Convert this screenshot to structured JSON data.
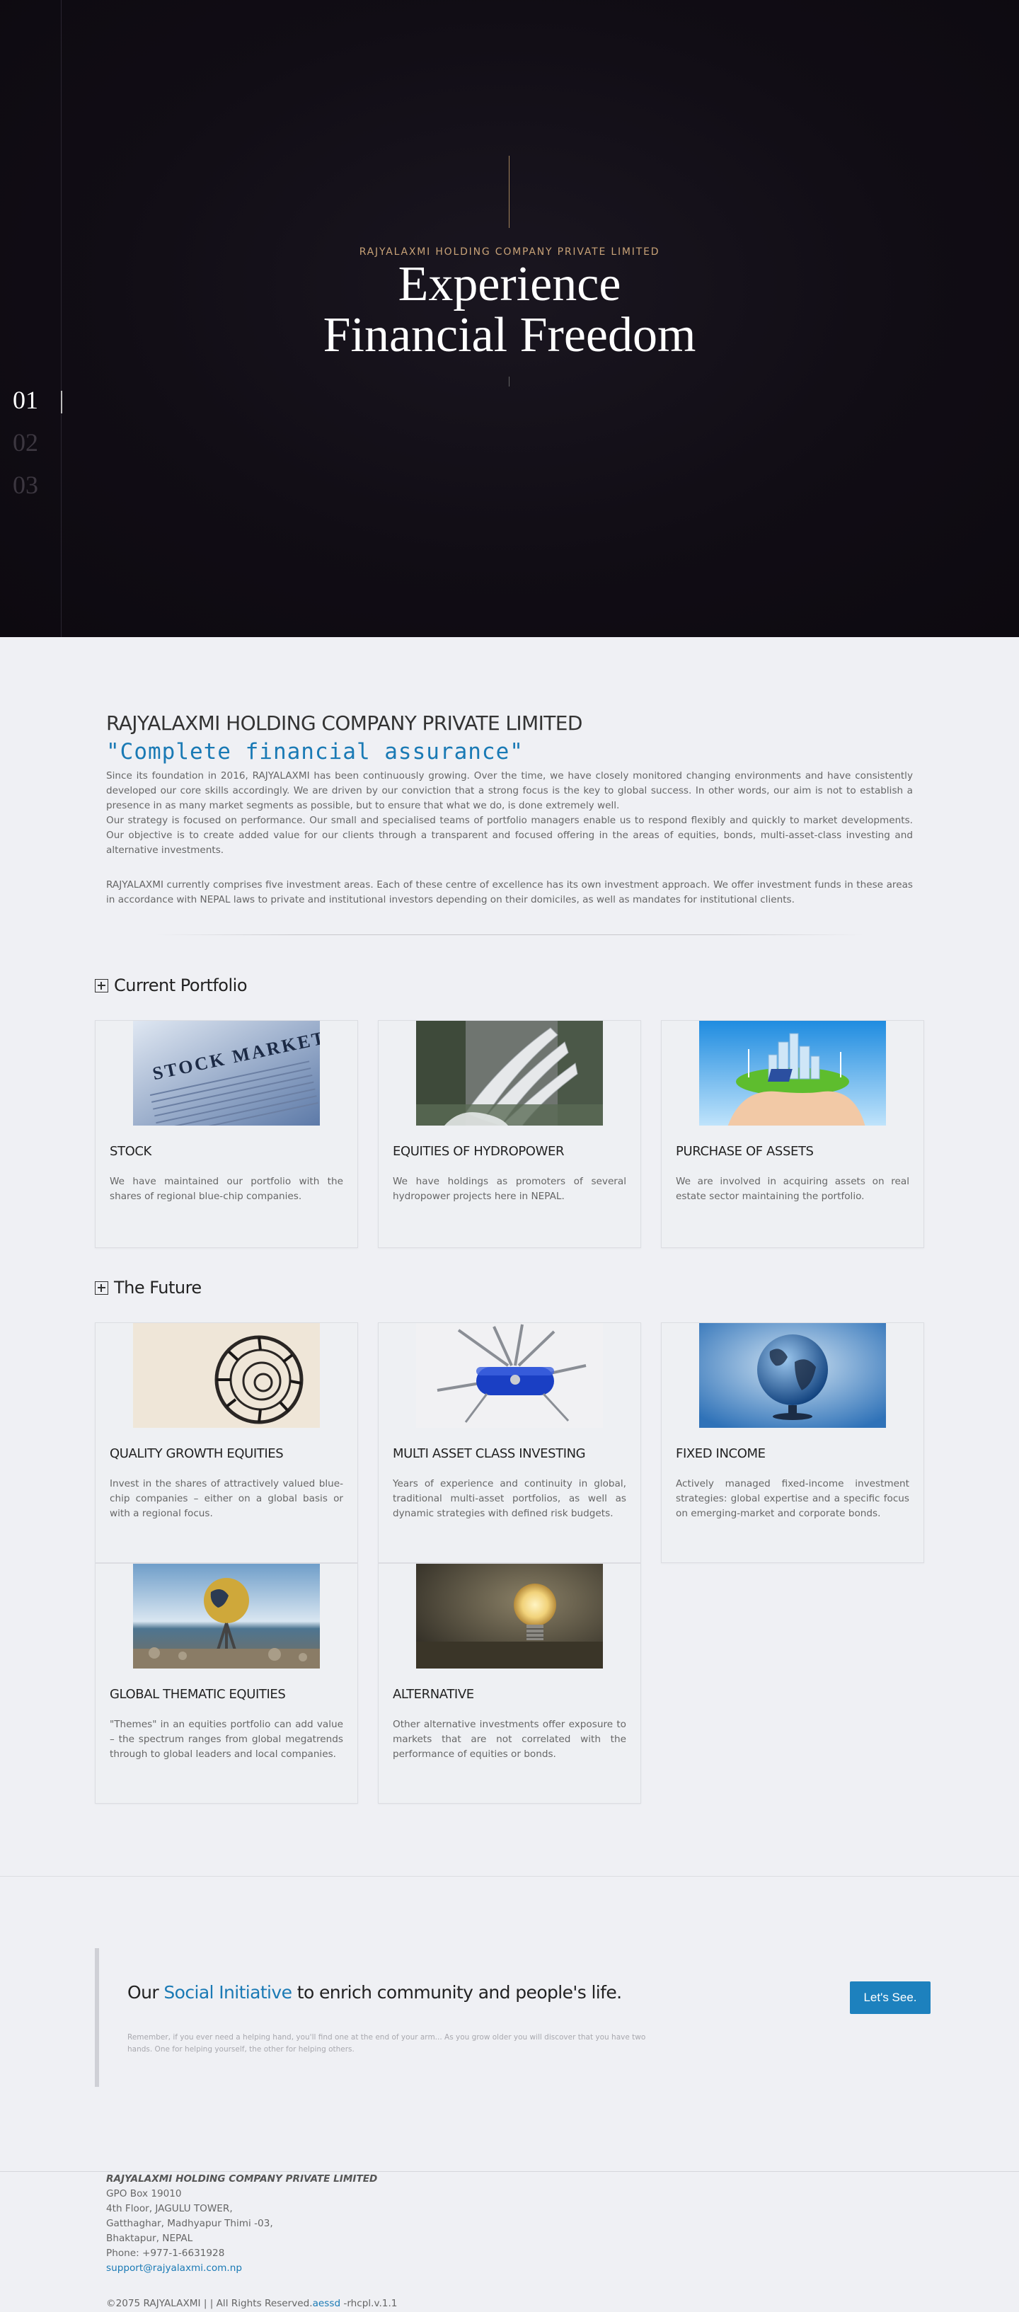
{
  "hero": {
    "kicker": "RAJYALAXMI HOLDING COMPANY PRIVATE LIMITED",
    "title_line1": "Experience",
    "title_line2": "Financial Freedom",
    "slides": [
      "01",
      "02",
      "03"
    ],
    "active_slide": 1
  },
  "about": {
    "company": "RAJYALAXMI HOLDING COMPANY PRIVATE LIMITED",
    "tagline": "\"Complete financial assurance\"",
    "para1": "Since its foundation in 2016, RAJYALAXMI has been continuously growing. Over the time, we have closely monitored changing environments and have consistently developed our core skills accordingly. We are driven by our conviction that a strong focus is the key to global success. In other words, our aim is not to establish a presence in as many market segments as possible, but to ensure that what we do, is done extremely well.",
    "para2": "Our strategy is focused on performance. Our small and specialised teams of portfolio managers enable us to respond flexibly and quickly to market developments. Our objective is to create added value for our clients through a transparent and focused offering in the areas of equities, bonds, multi-asset-class investing and alternative investments.",
    "para3": "RAJYALAXMI currently comprises five investment areas. Each of these centre of excellence has its own investment approach. We offer investment funds in these areas in accordance with NEPAL laws to private and institutional investors depending on their domiciles, as well as mandates for institutional clients."
  },
  "portfolio": {
    "heading": "Current Portfolio",
    "items": [
      {
        "title": "STOCK",
        "text": "We have maintained our portfolio with the shares of regional blue-chip companies.",
        "image": "stock-markets-newspaper-image"
      },
      {
        "title": "EQUITIES OF HYDROPOWER",
        "text": "We have holdings as promoters of several hydropower projects here in NEPAL.",
        "image": "dam-spillway-image"
      },
      {
        "title": "PURCHASE OF ASSETS",
        "text": "We are involved in acquiring assets on real estate sector maintaining the portfolio.",
        "image": "hands-holding-green-city-image"
      }
    ]
  },
  "future": {
    "heading": "The Future",
    "items": [
      {
        "title": "QUALITY GROWTH EQUITIES",
        "text": "Invest in the shares of attractively valued blue-chip companies – either on a global basis or with a regional focus.",
        "image": "spiral-staircase-image"
      },
      {
        "title": "MULTI ASSET CLASS INVESTING",
        "text": "Years of experience and continuity in global, traditional multi-asset portfolios, as well as dynamic strategies with defined risk budgets.",
        "image": "swiss-army-knife-image"
      },
      {
        "title": "FIXED INCOME",
        "text": "Actively managed fixed-income investment strategies: global expertise and a specific focus on emerging-market and corporate bonds.",
        "image": "glass-globe-image"
      },
      {
        "title": "GLOBAL THEMATIC EQUITIES",
        "text": "\"Themes\" in an equities portfolio can add value – the spectrum ranges from global megatrends through to global leaders and local companies.",
        "image": "globe-sculpture-seaside-image"
      },
      {
        "title": "ALTERNATIVE",
        "text": "Other alternative investments offer exposure to markets that are not correlated with the performance of equities or bonds.",
        "image": "light-bulb-image"
      }
    ]
  },
  "cta": {
    "heading_pre": "Our ",
    "heading_accent": "Social Initiative",
    "heading_post": " to enrich community and people's life.",
    "quote": "Remember, if you ever need a helping hand, you'll find one at the end of your arm... As you grow older you will discover that you have two hands. One for helping yourself, the other for helping others.",
    "button": "Let's See."
  },
  "footer": {
    "company": "RAJYALAXMI HOLDING COMPANY PRIVATE LIMITED",
    "address": [
      "GPO Box 19010",
      "4th Floor, JAGULU TOWER,",
      "Gatthaghar, Madhyapur Thimi -03,",
      "Bhaktapur, NEPAL"
    ],
    "phone": "Phone: +977-1-6631928",
    "email": "support@rajyalaxmi.com.np",
    "copyright": "©2075 RAJYALAXMI | | All Rights Reserved.",
    "credit_link": "aessd",
    "version": " -rhcpl.v.1.1"
  },
  "colors": {
    "accent": "#1a7ab5",
    "hero_bg": "#110d15",
    "kicker": "#c8a277",
    "button": "#1d81be"
  }
}
